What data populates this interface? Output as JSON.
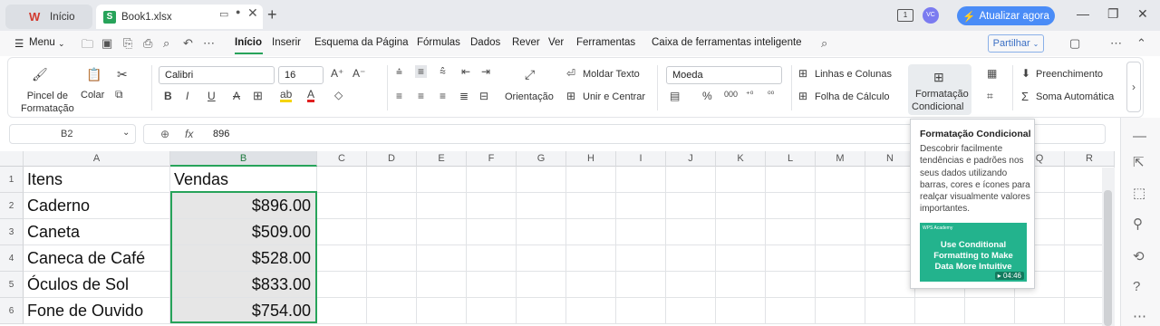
{
  "tabs": {
    "home": {
      "label": "Início"
    },
    "book": {
      "label": "Book1.xlsx"
    }
  },
  "titlebar": {
    "upgrade_label": "Atualizar agora",
    "avatar_initials": "VC"
  },
  "menubar": {
    "menu_label": "Menu",
    "items": [
      "Início",
      "Inserir",
      "Esquema da Página",
      "Fórmulas",
      "Dados",
      "Rever",
      "Ver",
      "Ferramentas",
      "Caixa de ferramentas inteligente"
    ],
    "share_label": "Partilhar"
  },
  "ribbon": {
    "format_painter": "Pincel de\nFormatação",
    "paste": "Colar",
    "font_name": "Calibri",
    "font_size": "16",
    "wrap_text": "Moldar Texto",
    "orientation": "Orientação",
    "merge_center": "Unir e Centrar",
    "number_format": "Moeda",
    "rows_columns": "Linhas e Colunas",
    "worksheet": "Folha de Cálculo",
    "conditional_formatting_line1": "Formatação",
    "conditional_formatting_line2": "Condicional",
    "fill": "Preenchimento",
    "autosum": "Soma Automática"
  },
  "formula_bar": {
    "name_box": "B2",
    "fx": "fx",
    "value": "896"
  },
  "columns": [
    "A",
    "B",
    "C",
    "D",
    "E",
    "F",
    "G",
    "H",
    "I",
    "J",
    "K",
    "L",
    "M",
    "N",
    "O",
    "P",
    "Q",
    "R"
  ],
  "rows": [
    {
      "num": "1",
      "a": "Itens",
      "b": "Vendas"
    },
    {
      "num": "2",
      "a": "Caderno",
      "b": "$896.00"
    },
    {
      "num": "3",
      "a": "Caneta",
      "b": "$509.00"
    },
    {
      "num": "4",
      "a": "Caneca de Café",
      "b": "$528.00"
    },
    {
      "num": "5",
      "a": "Óculos de Sol",
      "b": "$833.00"
    },
    {
      "num": "6",
      "a": "Fone de Ouvido",
      "b": "$754.00"
    }
  ],
  "tooltip": {
    "title": "Formatação Condicional",
    "description": "Descobrir facilmente tendências e padrões nos seus dados utilizando barras, cores e ícones para realçar visualmente valores importantes.",
    "video_brand": "WPS Academy",
    "video_title": "Use Conditional Formatting to Make Data More Intuitive",
    "video_duration": "04:46"
  },
  "colors": {
    "accent": "#27a35a",
    "upgrade": "#4a8cf7"
  }
}
